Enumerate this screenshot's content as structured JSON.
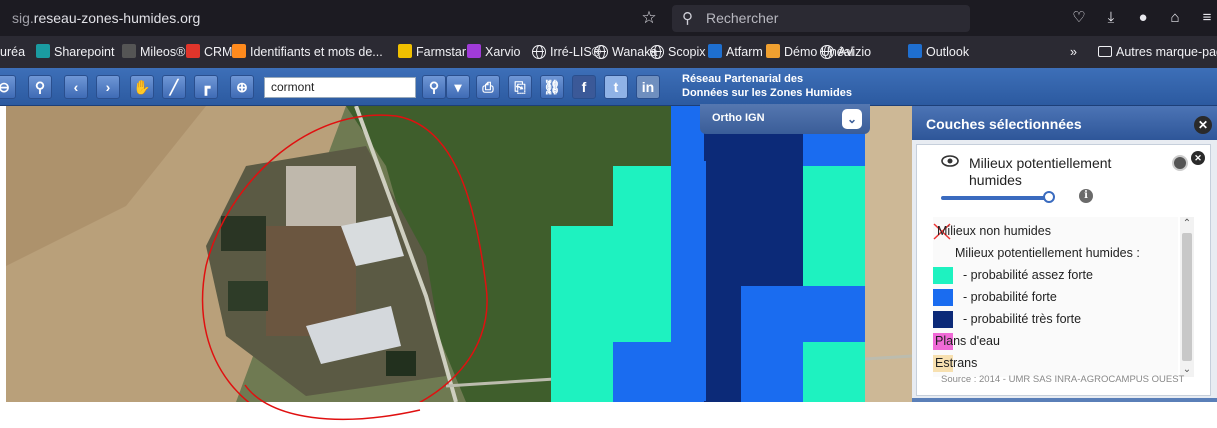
{
  "browser": {
    "url_domain": "sig.",
    "url_rest": "reseau-zones-humides.org",
    "search_placeholder": "Rechercher",
    "bookmarks": [
      {
        "label": "uréa",
        "icon": "none",
        "color": ""
      },
      {
        "label": "Sharepoint",
        "icon": "sharepoint-icon",
        "color": "#1a9ba1"
      },
      {
        "label": "Mileos®",
        "icon": "mileos-icon",
        "color": "#555555"
      },
      {
        "label": "CRM",
        "icon": "crm-icon",
        "color": "#e0352b"
      },
      {
        "label": "Identifiants et mots de...",
        "icon": "firefox-icon",
        "color": "#ff8a1d"
      },
      {
        "label": "Farmstar",
        "icon": "farmstar-icon",
        "color": "#f0c000"
      },
      {
        "label": "Xarvio",
        "icon": "xarvio-icon",
        "color": "#a03bd8"
      },
      {
        "label": "Irré-LIS®",
        "icon": "globe-icon",
        "color": ""
      },
      {
        "label": "Wanaka",
        "icon": "globe-icon",
        "color": ""
      },
      {
        "label": "Scopix",
        "icon": "globe-icon",
        "color": ""
      },
      {
        "label": "Atfarm",
        "icon": "atfarm-icon",
        "color": "#1e6fd0"
      },
      {
        "label": "Démo Unéal",
        "icon": "uneal-icon",
        "color": "#f0a030"
      },
      {
        "label": "Avizio",
        "icon": "globe-icon",
        "color": ""
      },
      {
        "label": "Outlook",
        "icon": "outlook-icon",
        "color": "#1f6fd0"
      },
      {
        "label": "»",
        "icon": "none",
        "color": ""
      },
      {
        "label": "Autres marque-pag",
        "icon": "folder-icon",
        "color": ""
      }
    ]
  },
  "toolbar": {
    "search_value": "cormont",
    "brand_line1": "Réseau Partenarial des",
    "brand_line2": "Données sur les Zones Humides"
  },
  "basemap": {
    "label": "Ortho IGN"
  },
  "layers_panel": {
    "title": "Couches sélectionnées",
    "layer_name": "Milieux potentiellement humides",
    "opacity": 0.9,
    "legend": {
      "non_humid": "Milieux non humides",
      "humid_header": "Milieux potentiellement humides :",
      "items": [
        {
          "label": "- probabilité assez forte",
          "color": "#1ef2c0"
        },
        {
          "label": "- probabilité forte",
          "color": "#1a6cf0"
        },
        {
          "label": "- probabilité très forte",
          "color": "#0c2a78"
        }
      ],
      "water": {
        "label": "Plans d'eau",
        "color": "#f06ad6"
      },
      "estran": {
        "label": "Estrans",
        "color": "#f7e0b0"
      }
    },
    "source": "Source : 2014 - UMR SAS INRA-AGROCAMPUS OUEST"
  },
  "colors": {
    "annotation_circle": "#e01010",
    "toolbar_blue": "#2c5aa0"
  }
}
